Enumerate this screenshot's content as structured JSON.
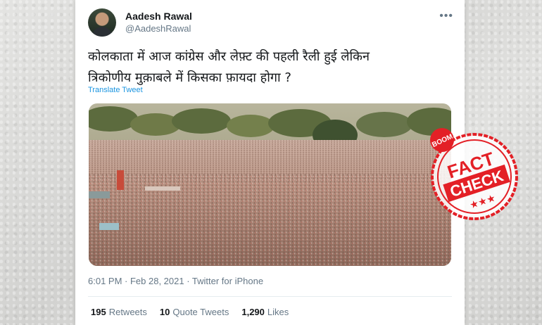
{
  "tweet": {
    "author_name": "Aadesh Rawal",
    "handle": "@AadeshRawal",
    "more_icon": "more-horizontal-icon",
    "text_line1": "कोलकाता में आज कांग्रेस और लेफ़्ट की पहली रैली हुई लेकिन",
    "text_line2": "त्रिकोणीय मुक़ाबले में किसका फ़ायदा होगा ?",
    "translate_label": "Translate Tweet",
    "timestamp": "6:01 PM · Feb 28, 2021 · Twitter for iPhone",
    "stats": [
      {
        "count": "195",
        "label": "Retweets"
      },
      {
        "count": "10",
        "label": "Quote Tweets"
      },
      {
        "count": "1,290",
        "label": "Likes"
      }
    ]
  },
  "badge": {
    "top": "BOOM",
    "line1": "FACT",
    "line2": "CHECK",
    "stars": "★★★",
    "color": "#e32026"
  }
}
